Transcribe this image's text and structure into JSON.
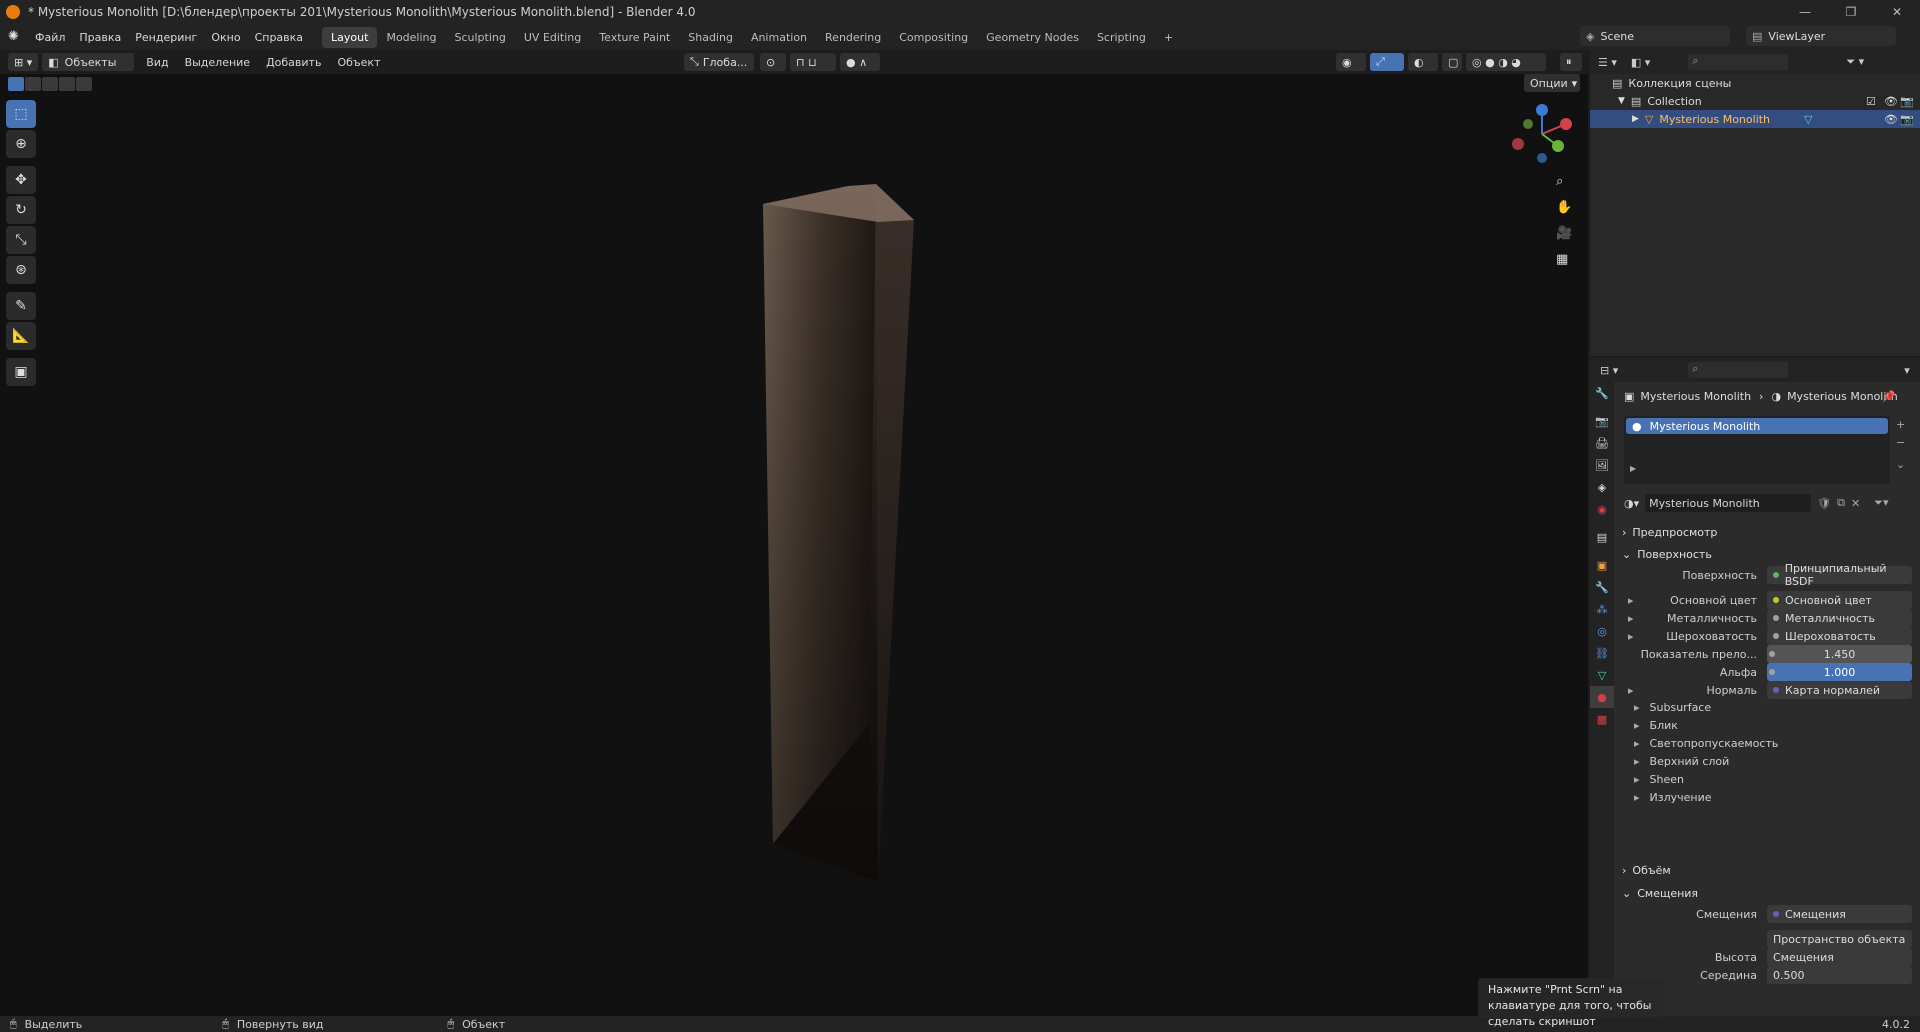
{
  "window": {
    "title": "* Mysterious Monolith [D:\\блендер\\проекты 201\\Mysterious Monolith\\Mysterious Monolith.blend] - Blender 4.0",
    "buttons": [
      "—",
      "❐",
      "✕"
    ]
  },
  "menu": [
    "Файл",
    "Правка",
    "Рендеринг",
    "Окно",
    "Справка"
  ],
  "workspaces": [
    {
      "label": "Layout",
      "active": true
    },
    {
      "label": "Modeling"
    },
    {
      "label": "Sculpting"
    },
    {
      "label": "UV Editing"
    },
    {
      "label": "Texture Paint"
    },
    {
      "label": "Shading"
    },
    {
      "label": "Animation"
    },
    {
      "label": "Rendering"
    },
    {
      "label": "Compositing"
    },
    {
      "label": "Geometry Nodes"
    },
    {
      "label": "Scripting"
    },
    {
      "label": "+"
    }
  ],
  "scene": {
    "label": "Scene",
    "viewlayer": "ViewLayer"
  },
  "header": {
    "mode": "Объекты",
    "menus": [
      "Вид",
      "Выделение",
      "Добавить",
      "Объект"
    ],
    "transform": "Глоба...",
    "options": "Опции"
  },
  "outliner": {
    "root": "Коллекция сцены",
    "collection": "Collection",
    "object": "Mysterious Monolith"
  },
  "properties": {
    "breadcrumb_object": "Mysterious Monolith",
    "breadcrumb_material": "Mysterious Monolith",
    "slot": "Mysterious Monolith",
    "material_name": "Mysterious Monolith",
    "sections": {
      "preview": "Предпросмотр",
      "surface": "Поверхность",
      "volume": "Объём",
      "displacement": "Смещения"
    },
    "rows": [
      {
        "label": "Поверхность",
        "value": "Принципиальный BSDF",
        "dot": "#5fb35f"
      },
      {
        "label": "Основной цвет",
        "value": "Основной цвет",
        "dot": "#c7c729",
        "expand": true
      },
      {
        "label": "Металличность",
        "value": "Металличность",
        "dot": "#a1a1a1",
        "expand": true
      },
      {
        "label": "Шероховатость",
        "value": "Шероховатость",
        "dot": "#a1a1a1",
        "expand": true
      },
      {
        "label": "Показатель прело...",
        "value": "1.450",
        "dot": "#a1a1a1",
        "num": true
      },
      {
        "label": "Альфа",
        "value": "1.000",
        "dot": "#a1a1a1",
        "num": true,
        "blue": true
      },
      {
        "label": "Нормаль",
        "value": "Карта нормалей",
        "dot": "#6363c7",
        "expand": true
      }
    ],
    "subs": [
      "Subsurface",
      "Блик",
      "Светопропускаемость",
      "Верхний слой",
      "Sheen",
      "Излучение"
    ],
    "displacement_rows": [
      {
        "label": "Смещения",
        "value": "Смещения",
        "dot": "#6363c7"
      },
      {
        "label": "",
        "value": "Пространство объекта"
      },
      {
        "label": "Высота",
        "value": "Смещения"
      },
      {
        "label": "Середина",
        "value": "0.500"
      }
    ]
  },
  "status": {
    "select": "Выделить",
    "rotate": "Повернуть вид",
    "object": "Объект",
    "version": "4.0.2"
  },
  "toast": "Нажмите \"Prnt Scrn\" на клавиатуре для того, чтобы сделать скриншот",
  "colors": {
    "accent": "#4772b3",
    "bg": "#1d1d1d",
    "viewport": "#111111"
  }
}
